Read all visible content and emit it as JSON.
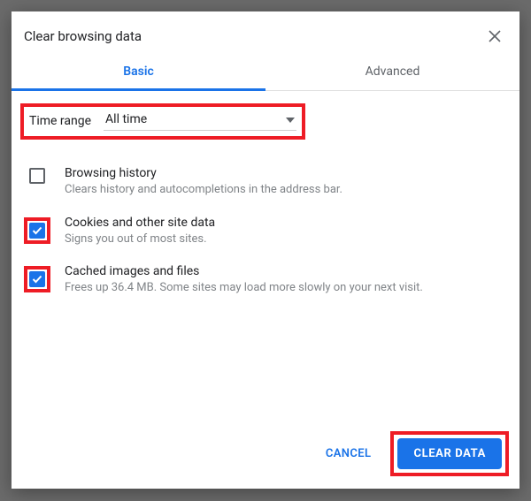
{
  "dialog": {
    "title": "Clear browsing data",
    "tabs": {
      "basic": "Basic",
      "advanced": "Advanced",
      "active": "basic"
    },
    "timeRange": {
      "label": "Time range",
      "value": "All time"
    },
    "options": [
      {
        "id": "browsing-history",
        "title": "Browsing history",
        "description": "Clears history and autocompletions in the address bar.",
        "checked": false,
        "highlighted": false
      },
      {
        "id": "cookies",
        "title": "Cookies and other site data",
        "description": "Signs you out of most sites.",
        "checked": true,
        "highlighted": true
      },
      {
        "id": "cache",
        "title": "Cached images and files",
        "description": "Frees up 36.4 MB. Some sites may load more slowly on your next visit.",
        "checked": true,
        "highlighted": true
      }
    ],
    "buttons": {
      "cancel": "CANCEL",
      "confirm": "CLEAR DATA"
    }
  },
  "annotations": {
    "highlightColor": "#ee1c25"
  }
}
